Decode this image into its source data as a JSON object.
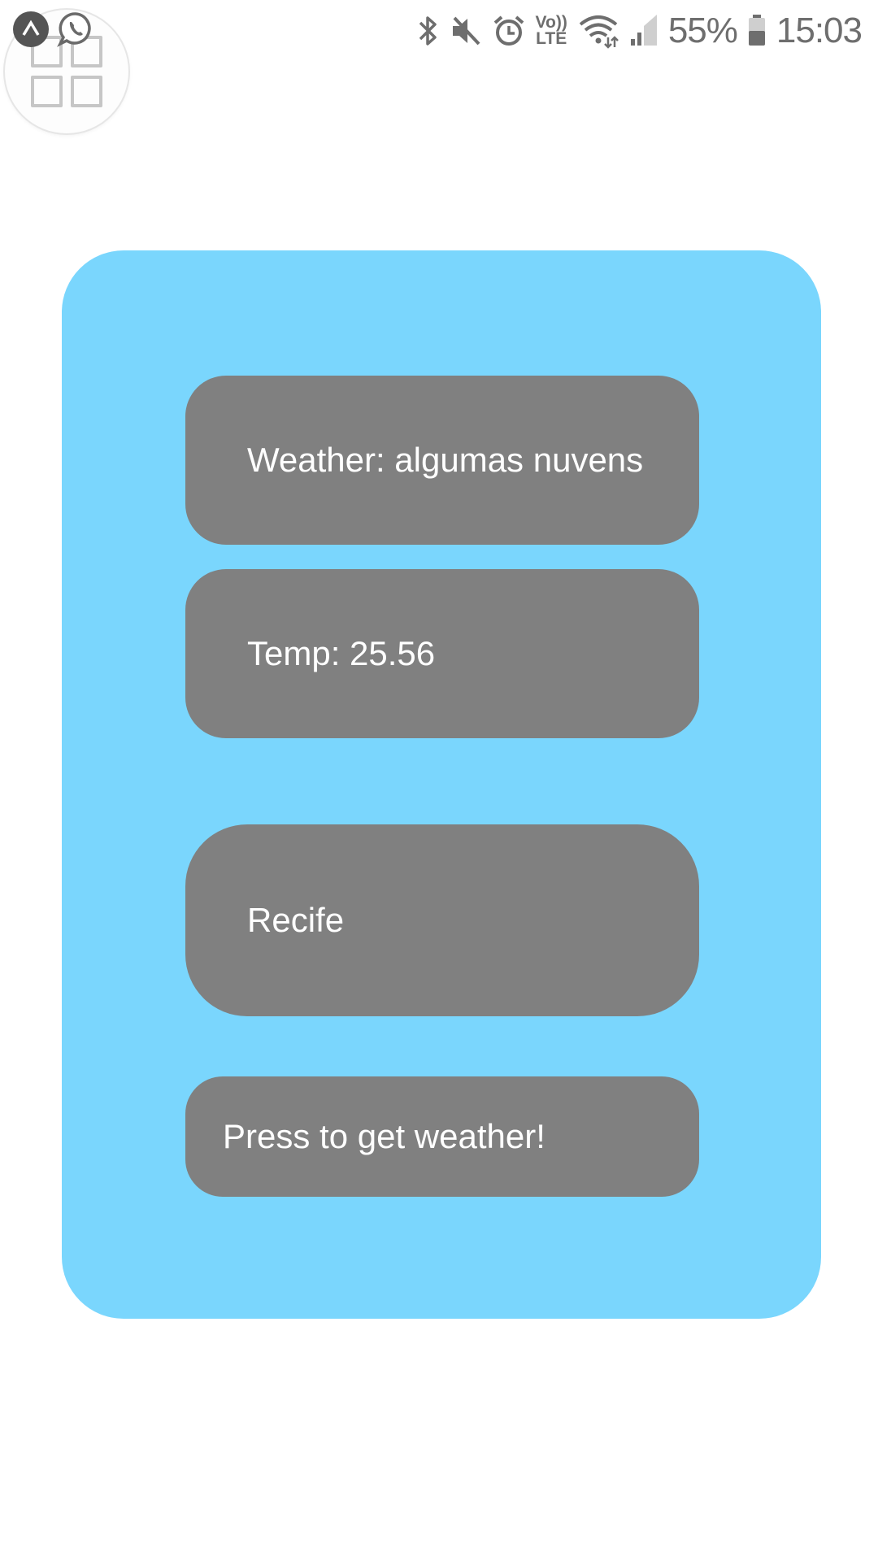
{
  "status_bar": {
    "battery_percent": "55%",
    "time": "15:03",
    "icons": [
      "bluetooth-icon",
      "mute-icon",
      "alarm-icon",
      "volte-icon",
      "wifi-icon",
      "signal-icon",
      "battery-icon"
    ],
    "volte_label_top": "Vo))",
    "volte_label_bottom": "LTE"
  },
  "overlay": {
    "icons": [
      "app-badge-icon",
      "whatsapp-icon",
      "launcher-grid-icon"
    ]
  },
  "card": {
    "background": "#7ad6fd",
    "panel_color": "#808080",
    "weather_text": "Weather: algumas nuvens",
    "temp_text": "Temp: 25.56",
    "city_text": "Recife",
    "button_label": "Press to get weather!"
  }
}
